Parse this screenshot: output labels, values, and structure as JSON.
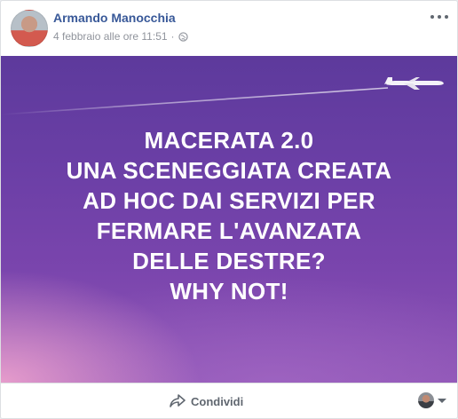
{
  "post": {
    "author_name": "Armando Manocchia",
    "timestamp": "4 febbraio alle ore 11:51",
    "separator": "·",
    "privacy_icon": "globe-icon",
    "more_icon": "more-options-icon"
  },
  "image": {
    "headline_lines": [
      "MACERATA 2.0",
      "UNA SCENEGGIATA CREATA",
      "AD HOC DAI SERVIZI PER",
      "FERMARE L'AVANZATA",
      "DELLE DESTRE?",
      "WHY NOT!"
    ],
    "graphic": "airplane-icon",
    "colors": {
      "background_top": "#5d3a9c",
      "background_bottom": "#8e55b6",
      "glow": "#eba0cd",
      "text": "#ffffff"
    }
  },
  "footer": {
    "share_label": "Condividi",
    "share_icon": "share-arrow-icon",
    "viewer_icon": "avatar-icon",
    "dropdown_icon": "caret-down-icon"
  },
  "colors": {
    "author_link": "#385898",
    "meta_text": "#90949c",
    "action_text": "#606770"
  }
}
